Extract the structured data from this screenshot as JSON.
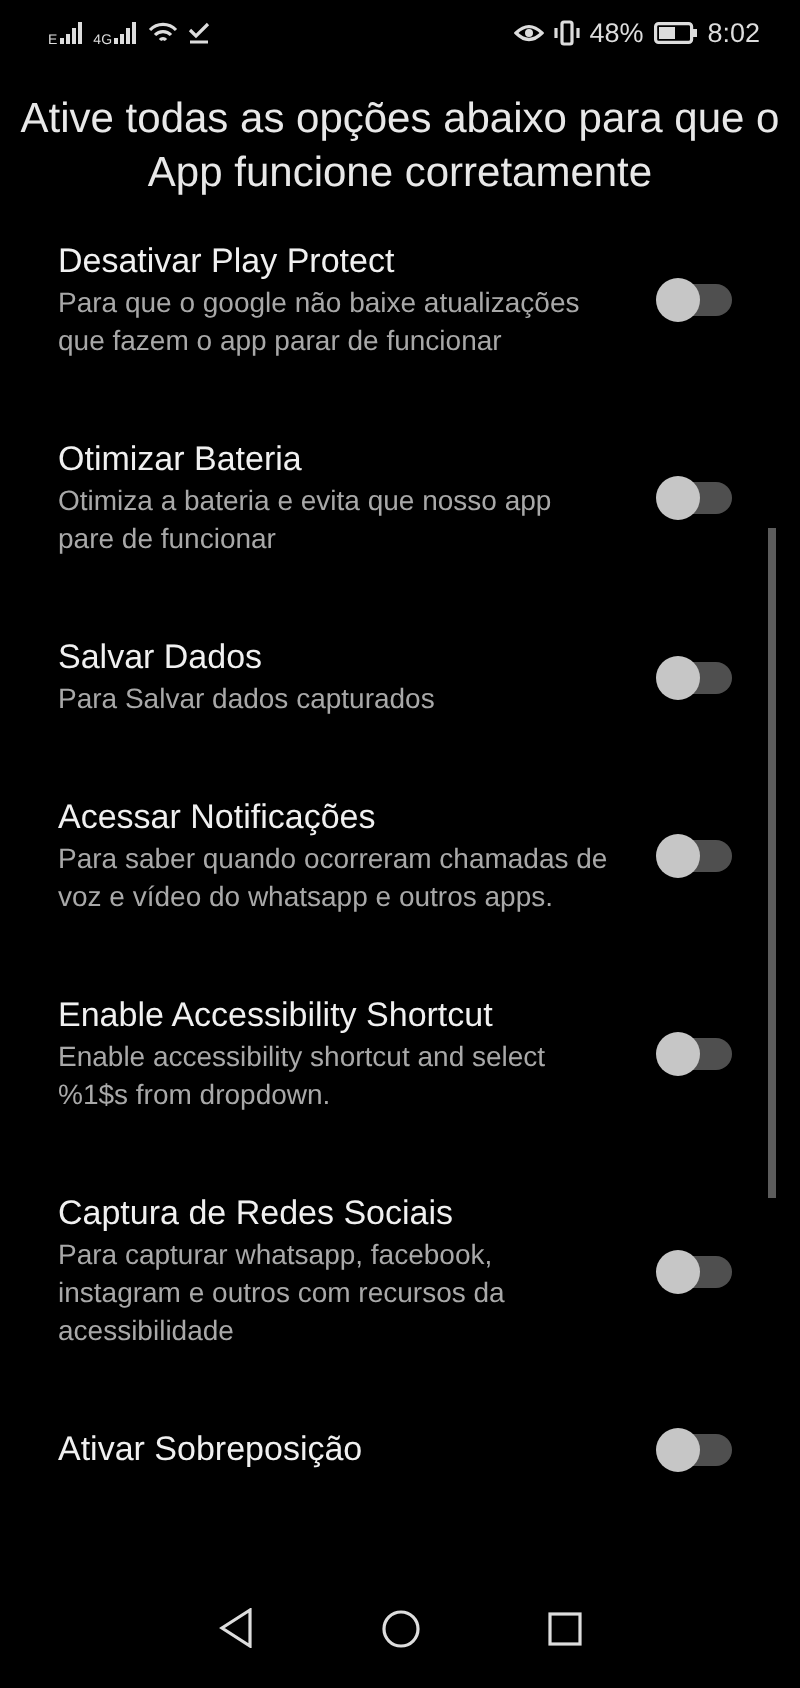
{
  "status_bar": {
    "network_1": "E",
    "network_2": "4G",
    "battery": "48%",
    "time": "8:02"
  },
  "header": {
    "title": "Ative todas as opções abaixo para que o App funcione corretamente"
  },
  "settings": [
    {
      "title": "Desativar Play Protect",
      "description": "Para que o google não baixe atualizações que fazem o app parar de funcionar",
      "on": false
    },
    {
      "title": "Otimizar Bateria",
      "description": "Otimiza a bateria e evita que nosso app pare de funcionar",
      "on": false
    },
    {
      "title": "Salvar Dados",
      "description": "Para Salvar dados capturados",
      "on": false
    },
    {
      "title": "Acessar Notificações",
      "description": "Para saber quando ocorreram chamadas de voz e vídeo do whatsapp e outros apps.",
      "on": false
    },
    {
      "title": "Enable Accessibility Shortcut",
      "description": "Enable accessibility shortcut and select %1$s from dropdown.",
      "on": false
    },
    {
      "title": "Captura de Redes Sociais",
      "description": "Para capturar whatsapp, facebook, instagram e outros com recursos da acessibilidade",
      "on": false
    },
    {
      "title": "Ativar Sobreposição",
      "on": false
    }
  ]
}
